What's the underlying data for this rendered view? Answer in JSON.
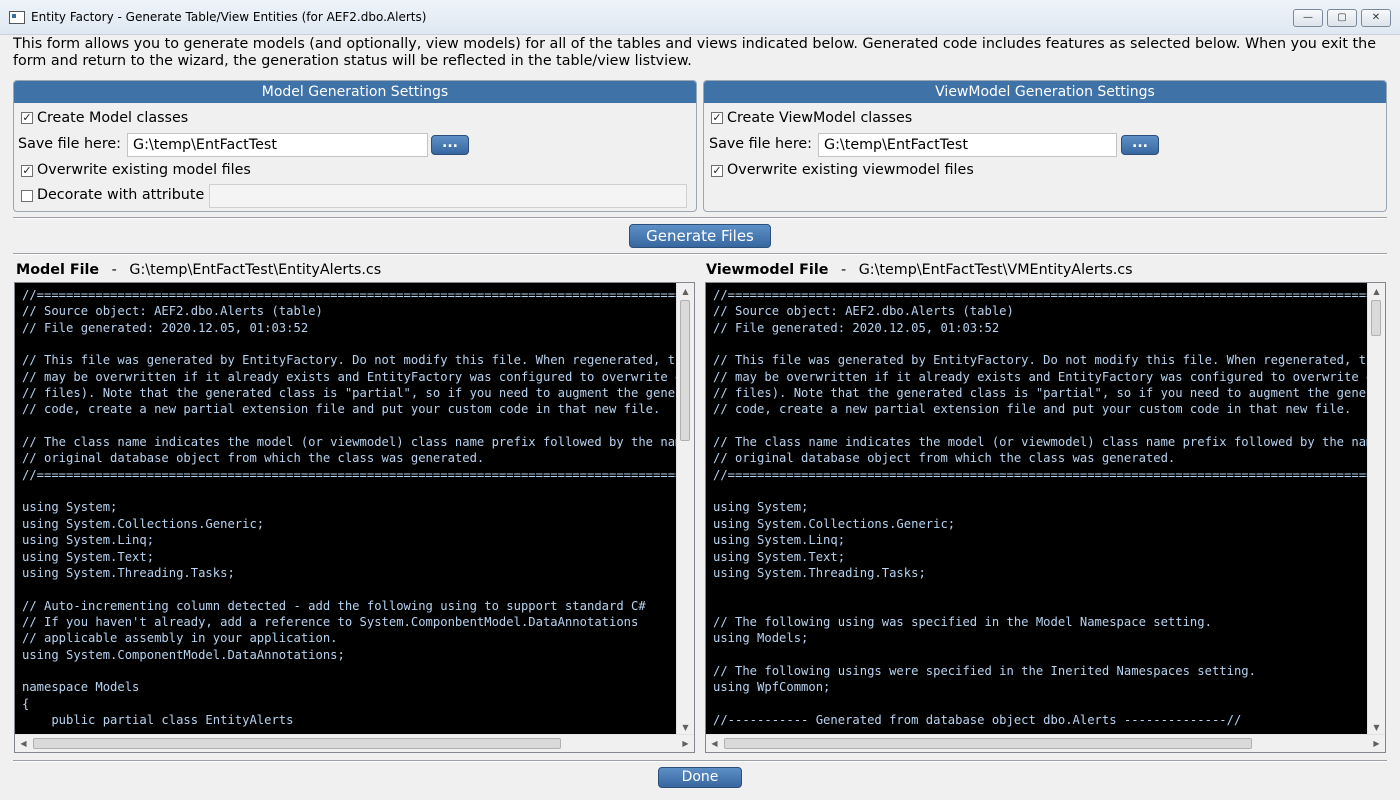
{
  "window": {
    "title": "Entity Factory - Generate Table/View Entities (for AEF2.dbo.Alerts)",
    "minimize_glyph": "—",
    "maximize_glyph": "▢",
    "close_glyph": "✕"
  },
  "intro_text": "This form allows you to generate models (and optionally, view models) for all of the tables and views indicated below. Generated code includes features as selected below. When you exit the form and return to the wizard, the generation status will be reflected in the table/view listview.",
  "model_settings": {
    "header": "Model Generation Settings",
    "create_label": "Create Model classes",
    "create_checked": true,
    "save_label": "Save file here:",
    "save_path": "G:\\temp\\EntFactTest",
    "browse_label": "...",
    "overwrite_label": "Overwrite existing model files",
    "overwrite_checked": true,
    "decorate_label": "Decorate with attribute",
    "decorate_checked": false,
    "decorate_value": ""
  },
  "viewmodel_settings": {
    "header": "ViewModel Generation Settings",
    "create_label": "Create ViewModel classes",
    "create_checked": true,
    "save_label": "Save file here:",
    "save_path": "G:\\temp\\EntFactTest",
    "browse_label": "...",
    "overwrite_label": "Overwrite existing viewmodel files",
    "overwrite_checked": true
  },
  "generate_button": "Generate Files",
  "done_button": "Done",
  "check_glyph": "✓",
  "model_file": {
    "label": "Model File",
    "separator": "-",
    "path": "G:\\temp\\EntFactTest\\EntityAlerts.cs",
    "code": "//==========================================================================================\n// Source object: AEF2.dbo.Alerts (table)\n// File generated: 2020.12.05, 01:03:52\n\n// This file was generated by EntityFactory. Do not modify this file. When regenerated, this file\n// may be overwritten if it already exists and EntityFactory was configured to overwrite existing\n// files). Note that the generated class is \"partial\", so if you need to augment the generated\n// code, create a new partial extension file and put your custom code in that new file.\n\n// The class name indicates the model (or viewmodel) class name prefix followed by the name of the\n// original database object from which the class was generated.\n//==========================================================================================\n\nusing System;\nusing System.Collections.Generic;\nusing System.Linq;\nusing System.Text;\nusing System.Threading.Tasks;\n\n// Auto-incrementing column detected - add the following using to support standard C#\n// If you haven't already, add a reference to System.ComponbentModel.DataAnnotations\n// applicable assembly in your application.\nusing System.ComponentModel.DataAnnotations;\n\nnamespace Models\n{\n    public partial class EntityAlerts"
  },
  "viewmodel_file": {
    "label": "Viewmodel File",
    "separator": "-",
    "path": "G:\\temp\\EntFactTest\\VMEntityAlerts.cs",
    "code": "//==========================================================================================\n// Source object: AEF2.dbo.Alerts (table)\n// File generated: 2020.12.05, 01:03:52\n\n// This file was generated by EntityFactory. Do not modify this file. When regenerated, this file\n// may be overwritten if it already exists and EntityFactory was configured to overwrite existing\n// files). Note that the generated class is \"partial\", so if you need to augment the generated\n// code, create a new partial extension file and put your custom code in that new file.\n\n// The class name indicates the model (or viewmodel) class name prefix followed by the name of the\n// original database object from which the class was generated.\n//==========================================================================================\n\nusing System;\nusing System.Collections.Generic;\nusing System.Linq;\nusing System.Text;\nusing System.Threading.Tasks;\n\n\n// The following using was specified in the Model Namespace setting.\nusing Models;\n\n// The following usings were specified in the Inerited Namespaces setting.\nusing WpfCommon;\n\n//----------- Generated from database object dbo.Alerts --------------//"
  },
  "scroll_glyphs": {
    "up": "▲",
    "down": "▼",
    "left": "◀",
    "right": "▶"
  }
}
